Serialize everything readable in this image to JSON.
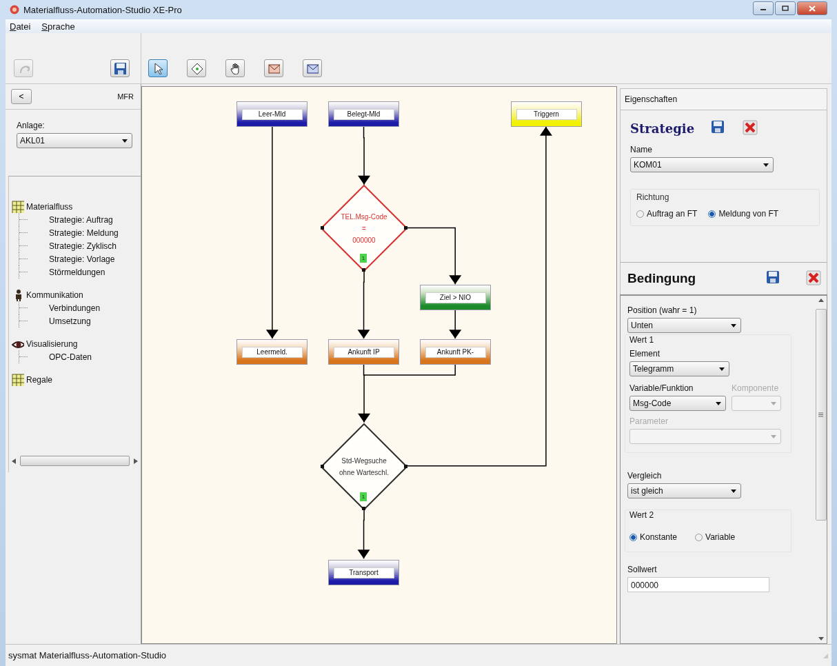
{
  "window": {
    "title": "Materialfluss-Automation-Studio XE-Pro"
  },
  "menu": [
    {
      "label": "Datei"
    },
    {
      "label": "Sprache"
    }
  ],
  "left_toolbar": [
    {
      "kind": "undo",
      "disabled": true
    },
    {
      "kind": "save",
      "disabled": false
    }
  ],
  "tools": [
    {
      "kind": "pointer",
      "selected": true
    },
    {
      "kind": "diamond",
      "selected": false
    },
    {
      "kind": "hand",
      "selected": false
    },
    {
      "kind": "letter",
      "selected": false
    },
    {
      "kind": "form",
      "selected": false
    }
  ],
  "nav": {
    "back": "<",
    "title": "MFR"
  },
  "anlage": {
    "label": "Anlage:",
    "value": "AKL01"
  },
  "tree": [
    {
      "label": "Materialfluss",
      "kind": "shelf",
      "children": [
        {
          "label": "Strategie: Auftrag"
        },
        {
          "label": "Strategie: Meldung"
        },
        {
          "label": "Strategie: Zyklisch"
        },
        {
          "label": "Strategie: Vorlage"
        },
        {
          "label": "Störmeldungen"
        }
      ]
    },
    {
      "label": "Kommunikation",
      "kind": "person",
      "children": [
        {
          "label": "Verbindungen"
        },
        {
          "label": "Umsetzung"
        }
      ]
    },
    {
      "label": "Visualisierung",
      "kind": "eye",
      "children": [
        {
          "label": "OPC-Daten"
        }
      ]
    },
    {
      "label": "Regale",
      "kind": "shelf"
    }
  ],
  "diagram": {
    "nodes": [
      {
        "kind": "block",
        "label": "Leer-Mld",
        "color": "#1c1ca8"
      },
      {
        "kind": "block",
        "label": "Belegt-Mld",
        "color": "#1c1ca8"
      },
      {
        "kind": "block",
        "label": "Triggern",
        "color": "#f0f000"
      },
      {
        "kind": "decision",
        "lines": [
          "TEL.Msg-Code",
          "=",
          "000000"
        ],
        "color": "#d83030",
        "badge": "1"
      },
      {
        "kind": "block",
        "label": "Ziel > NIO",
        "color": "#1a8a2a"
      },
      {
        "kind": "block",
        "label": "Leermeld.",
        "color": "#d8741c"
      },
      {
        "kind": "block",
        "label": "Ankunft IP",
        "color": "#d8741c"
      },
      {
        "kind": "block",
        "label": "Ankunft PK-",
        "color": "#d8741c"
      },
      {
        "kind": "decision",
        "lines": [
          "Std-Wegsuche",
          "ohne Warteschl."
        ],
        "color": "#303030",
        "badge": "1"
      },
      {
        "kind": "block",
        "label": "Transport",
        "color": "#1c1ca8"
      }
    ]
  },
  "properties": {
    "header": "Eigenschaften",
    "strategie": {
      "title": "Strategie",
      "name": {
        "label": "Name",
        "value": "KOM01"
      },
      "richtung": {
        "label": "Richtung",
        "options": [
          {
            "label": "Auftrag an FT",
            "selected": false
          },
          {
            "label": "Meldung von FT",
            "selected": true
          }
        ]
      }
    },
    "bedingung": {
      "title": "Bedingung",
      "position": {
        "label": "Position (wahr = 1)",
        "value": "Unten"
      },
      "wert1": {
        "label": "Wert 1",
        "element": {
          "label": "Element",
          "value": "Telegramm",
          "disabled": false
        },
        "variable": {
          "label": "Variable/Funktion",
          "value": "Msg-Code",
          "disabled": false
        },
        "komponente": {
          "label": "Komponente",
          "disabled": true
        },
        "parameter": {
          "label": "Parameter",
          "disabled": true
        }
      },
      "vergleich": {
        "label": "Vergleich",
        "value": "ist gleich"
      },
      "wert2": {
        "label": "Wert 2",
        "options": [
          {
            "label": "Konstante",
            "selected": true
          },
          {
            "label": "Variable",
            "selected": false
          }
        ]
      },
      "sollwert": {
        "label": "Sollwert",
        "value": "000000"
      }
    }
  },
  "status_bar": "sysmat Materialfluss-Automation-Studio"
}
